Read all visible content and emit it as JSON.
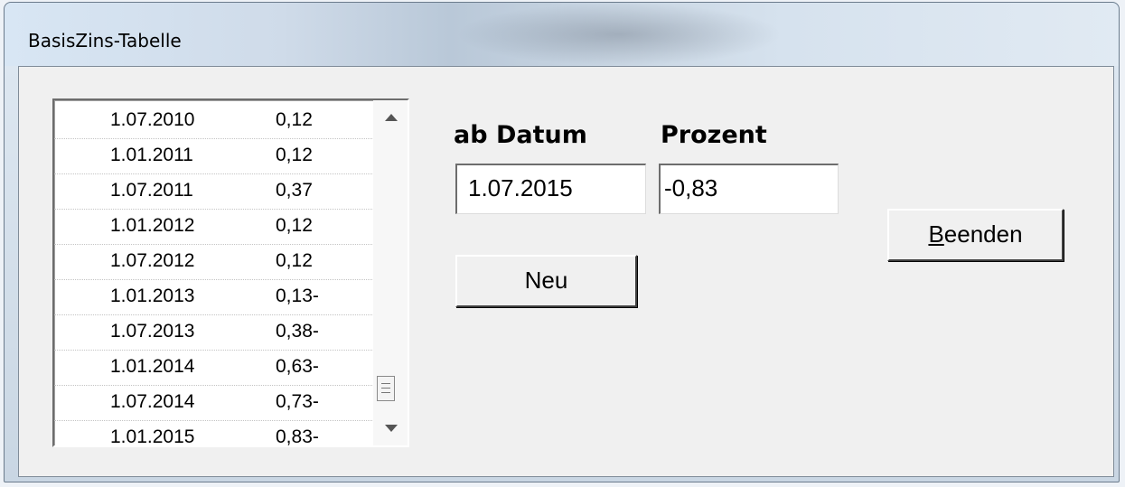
{
  "window": {
    "title": "BasisZins-Tabelle"
  },
  "list": {
    "rows": [
      {
        "date": "1.07.2010",
        "pct": "0,12"
      },
      {
        "date": "1.01.2011",
        "pct": "0,12"
      },
      {
        "date": "1.07.2011",
        "pct": "0,37"
      },
      {
        "date": "1.01.2012",
        "pct": "0,12"
      },
      {
        "date": "1.07.2012",
        "pct": "0,12"
      },
      {
        "date": "1.01.2013",
        "pct": "0,13-"
      },
      {
        "date": "1.07.2013",
        "pct": "0,38-"
      },
      {
        "date": "1.01.2014",
        "pct": "0,63-"
      },
      {
        "date": "1.07.2014",
        "pct": "0,73-"
      },
      {
        "date": "1.01.2015",
        "pct": "0,83-"
      }
    ]
  },
  "form": {
    "date_label": "ab Datum",
    "percent_label": "Prozent",
    "date_value": "1.07.2015",
    "percent_value": "-0,83",
    "new_button": "Neu",
    "exit_button_mnemonic": "B",
    "exit_button_rest": "eenden"
  }
}
